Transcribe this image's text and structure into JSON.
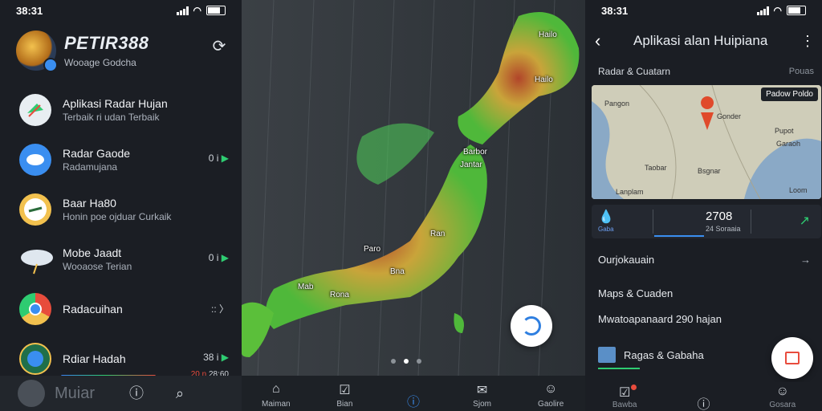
{
  "status_left": {
    "time": "38:31"
  },
  "status_right": {
    "time": "38:31"
  },
  "left": {
    "brand": "PETIR388",
    "brand_sub": "Wooage Godcha",
    "items": [
      {
        "title": "Aplikasi Radar Hujan",
        "subtitle": "Terbaik ri udan Terbaik",
        "trail": "",
        "icon": "umbrella-icon",
        "color": "#e8eef2"
      },
      {
        "title": "Radar Gaode",
        "subtitle": "Radamujana",
        "trail": "0 i",
        "icon": "cloud-icon",
        "color": "#3a8ef0"
      },
      {
        "title": "Baar Ha80",
        "subtitle": "Honin poe ojduar Curkaik",
        "trail": "",
        "icon": "weather-badge-icon",
        "color": "#f2c14e"
      },
      {
        "title": "Mobe Jaadt",
        "subtitle": "Wooaose Terian",
        "trail": "0 i",
        "icon": "storm-cloud-icon",
        "color": "#dfe7ef"
      },
      {
        "title": "Radacuihan",
        "subtitle": "",
        "trail": "::",
        "icon": "chrome-like-icon",
        "color": "#e74c3c"
      },
      {
        "title": "Rdiar Hadah",
        "subtitle": "",
        "trail": "38 i",
        "trail2": "20 n",
        "trail3": "28:60",
        "icon": "globe-icon",
        "color": "#2ecc71"
      }
    ],
    "bottom_name": "Muiar"
  },
  "map": {
    "labels": [
      "Hailo",
      "Hailo",
      "Barbor",
      "Jantar",
      "Ran",
      "Paro",
      "Bna",
      "Mab",
      "Rona"
    ],
    "nav": [
      "Maiman",
      "Bian",
      "",
      "Sjom",
      "Gaolire"
    ]
  },
  "right": {
    "title": "Aplikasi alan Huipiana",
    "section": "Radar & Cuatarn",
    "section_right": "Pouas",
    "map_badge": "Padow Poldo",
    "map_labels": [
      "Pangon",
      "Gonder",
      "Taobar",
      "Bsgnar",
      "Pupot",
      "Garaoh",
      "Lanplam",
      "Loom"
    ],
    "stats_title": "Gaba",
    "stats_value": "2708",
    "stats_sub": "24 Soraaia",
    "row1": "Ourjokauain",
    "row2": "Maps & Cuaden",
    "row3": "Mwatoapanaard 290 hajan",
    "row4": "Ragas & Gabaha",
    "nav": [
      "Bawba",
      "",
      "Gosara"
    ]
  }
}
